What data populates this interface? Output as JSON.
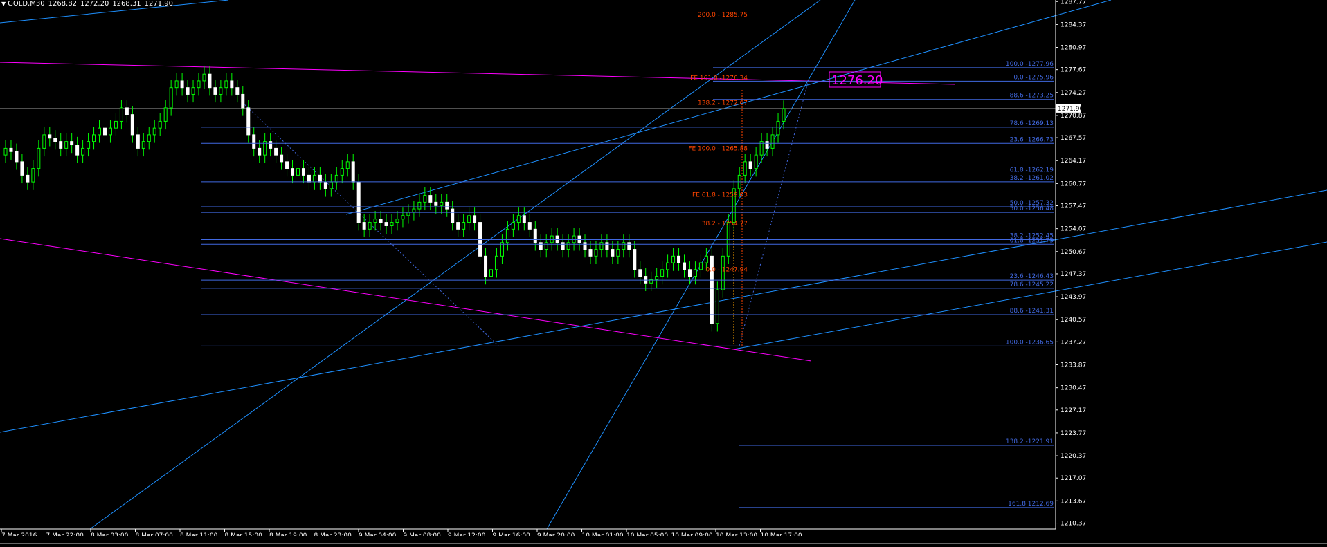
{
  "header": {
    "symbol": "GOLD,M30",
    "open": "1268.82",
    "high": "1272.20",
    "low": "1268.31",
    "close": "1271.90"
  },
  "price_label": "1276.20",
  "current_price_tag": "1271.90",
  "colors": {
    "background": "#000000",
    "axis": "#ffffff",
    "candle_up_fill": "#000000",
    "candle_up_body": "#ffffff",
    "candle_wick": "#00ff00",
    "fib_lines": "#4169e1",
    "trend_lines": "#1e90ff",
    "magenta_lines": "#ff00ff",
    "fe_labels": "#ff4500",
    "price_label": "#ff00ff"
  },
  "chart_data": {
    "type": "candlestick",
    "title": "",
    "xlabel": "",
    "ylabel": "",
    "ylim": [
      1209.5,
      1288.0
    ],
    "y_ticks": [
      "1287.77",
      "1284.37",
      "1280.97",
      "1277.67",
      "1274.27",
      "1270.87",
      "1267.57",
      "1264.17",
      "1260.77",
      "1257.47",
      "1254.07",
      "1250.67",
      "1247.37",
      "1243.97",
      "1240.57",
      "1237.27",
      "1233.87",
      "1230.47",
      "1227.17",
      "1223.77",
      "1220.37",
      "1217.07",
      "1213.67",
      "1210.37"
    ],
    "x_ticks": [
      "7 Mar 2016",
      "7 Mar 22:00",
      "8 Mar 03:00",
      "8 Mar 07:00",
      "8 Mar 11:00",
      "8 Mar 15:00",
      "8 Mar 19:00",
      "8 Mar 23:00",
      "9 Mar 04:00",
      "9 Mar 08:00",
      "9 Mar 12:00",
      "9 Mar 16:00",
      "9 Mar 20:00",
      "10 Mar 01:00",
      "10 Mar 05:00",
      "10 Mar 09:00",
      "10 Mar 13:00",
      "10 Mar 17:00"
    ],
    "candles_close": [
      1266,
      1265.5,
      1264,
      1262,
      1261,
      1263,
      1266,
      1268,
      1267.5,
      1267,
      1266,
      1267,
      1266.5,
      1265,
      1266,
      1267,
      1268,
      1269,
      1268,
      1269,
      1270,
      1272,
      1271,
      1268,
      1266,
      1267,
      1268,
      1269,
      1270,
      1272,
      1275,
      1276,
      1275,
      1274,
      1275,
      1276,
      1277,
      1275,
      1274,
      1275,
      1276,
      1275,
      1274,
      1272,
      1268,
      1266,
      1265,
      1267,
      1266,
      1265,
      1264,
      1263,
      1262,
      1263,
      1262,
      1261,
      1262,
      1261,
      1260,
      1261,
      1262,
      1263,
      1264,
      1261,
      1255,
      1254,
      1255,
      1255.5,
      1255,
      1254.5,
      1255,
      1255.5,
      1256,
      1256.5,
      1257,
      1258,
      1259,
      1258,
      1257.5,
      1258,
      1257,
      1255,
      1254,
      1255,
      1256,
      1255,
      1250,
      1247,
      1248,
      1250,
      1252,
      1254,
      1255,
      1256,
      1255,
      1254,
      1252,
      1251,
      1252,
      1253,
      1252,
      1251,
      1252,
      1253,
      1252,
      1251,
      1250,
      1251,
      1252,
      1251,
      1250,
      1251,
      1252,
      1251,
      1248,
      1247,
      1246,
      1246.5,
      1247,
      1248,
      1249,
      1250,
      1249,
      1248,
      1247,
      1248,
      1249,
      1250,
      1240,
      1245,
      1250,
      1255,
      1260,
      1262,
      1264,
      1263,
      1265,
      1267,
      1266,
      1268,
      1270,
      1271.9
    ],
    "fibonacci_levels": [
      {
        "label": "100.0 -1277.96",
        "value": 1277.96
      },
      {
        "label": "0.0 -1275.96",
        "value": 1275.96
      },
      {
        "label": "88.6 -1273.25",
        "value": 1273.25
      },
      {
        "label": "78.6 -1269.13",
        "value": 1269.13
      },
      {
        "label": "23.6 -1266.73",
        "value": 1266.73
      },
      {
        "label": "61.8 -1262.19",
        "value": 1262.19
      },
      {
        "label": "38.2 -1261.02",
        "value": 1261.02
      },
      {
        "label": "50.0 -1257.32",
        "value": 1257.32
      },
      {
        "label": "50.0 -1256.48",
        "value": 1256.48
      },
      {
        "label": "38.2 -1252.45",
        "value": 1252.45
      },
      {
        "label": "61.8 -1251.75",
        "value": 1251.75
      },
      {
        "label": "23.6 -1246.43",
        "value": 1246.43
      },
      {
        "label": "78.6 -1245.22",
        "value": 1245.22
      },
      {
        "label": "88.6 -1241.31",
        "value": 1241.31
      },
      {
        "label": "100.0 -1236.65",
        "value": 1236.65
      },
      {
        "label": "138.2 -1221.91",
        "value": 1221.91
      },
      {
        "label": "161.8 1212.69",
        "value": 1212.69
      }
    ],
    "fe_labels": [
      {
        "label": "200.0 - 1285.75",
        "value": 1285.75
      },
      {
        "label": "FE 161.8 -1276.34",
        "value": 1276.34
      },
      {
        "label": "138.2 - 1272.67",
        "value": 1272.67
      },
      {
        "label": "FE 100.0 - 1265.88",
        "value": 1265.88
      },
      {
        "label": "FE 61.8 - 1259.03",
        "value": 1259.03
      },
      {
        "label": "38.2 - 1254.77",
        "value": 1254.77
      },
      {
        "label": "0.0 - 1247.94",
        "value": 1247.94
      }
    ]
  }
}
